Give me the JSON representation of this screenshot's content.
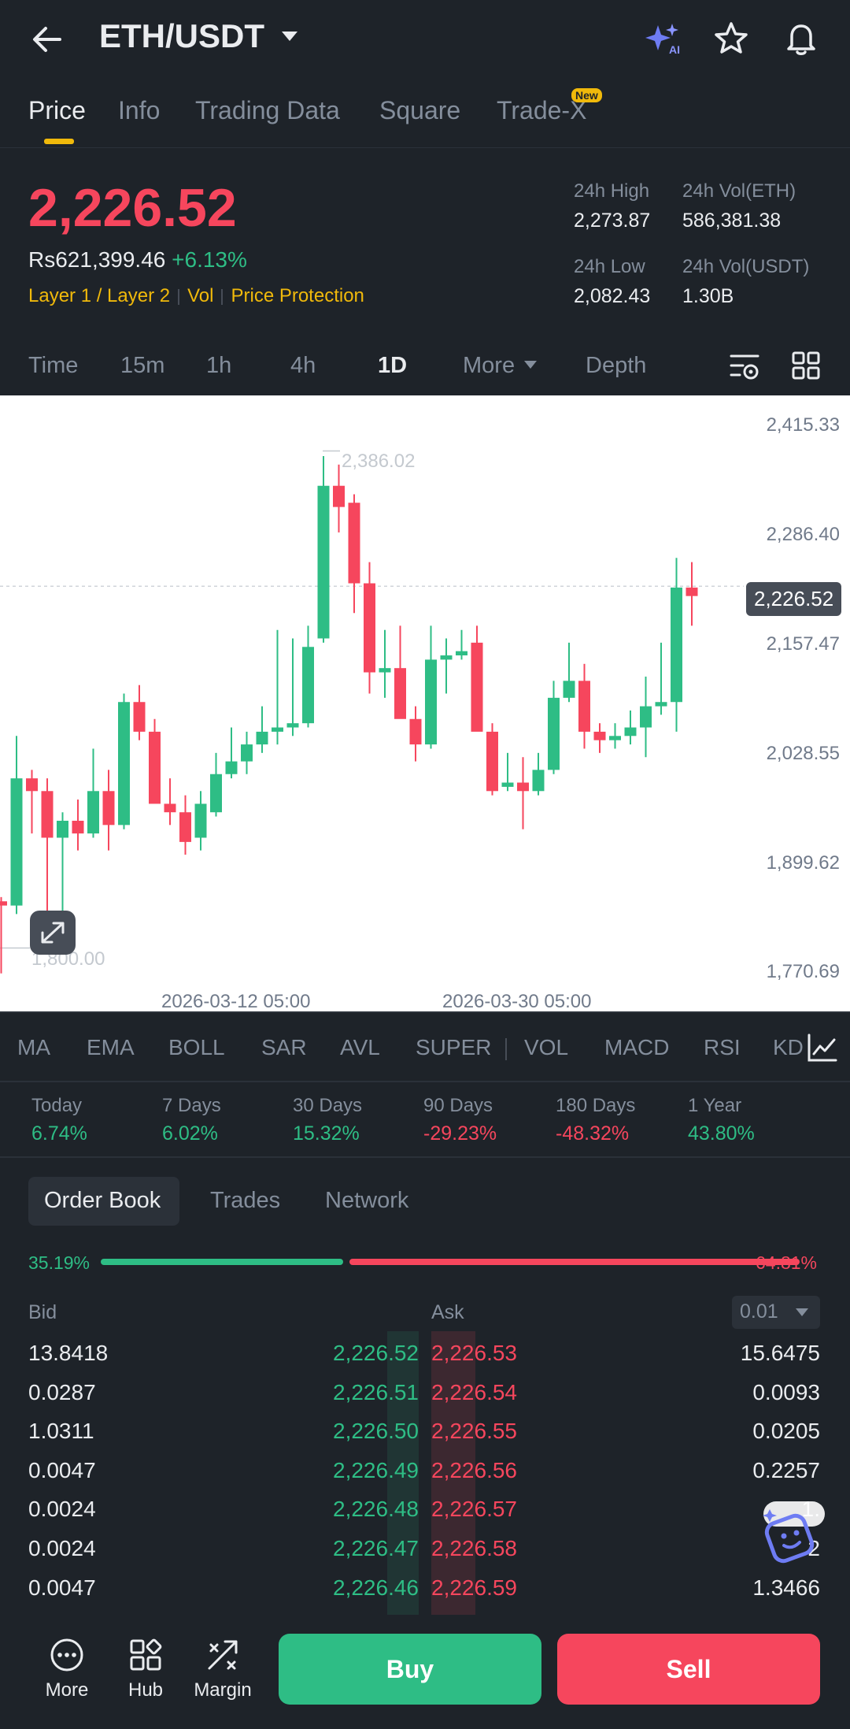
{
  "header": {
    "pair": "ETH/USDT"
  },
  "tabs": [
    {
      "label": "Price"
    },
    {
      "label": "Info"
    },
    {
      "label": "Trading Data"
    },
    {
      "label": "Square"
    },
    {
      "label": "Trade-X"
    }
  ],
  "new_badge": "New",
  "ticker": {
    "last_price": "2,226.52",
    "fiat_price": "Rs621,399.46",
    "change": "+6.13%",
    "tags": [
      "Layer 1 / Layer 2",
      "Vol",
      "Price Protection"
    ],
    "high_label": "24h High",
    "high": "2,273.87",
    "vol_base_label": "24h Vol(ETH)",
    "vol_base": "586,381.38",
    "low_label": "24h Low",
    "low": "2,082.43",
    "vol_quote_label": "24h Vol(USDT)",
    "vol_quote": "1.30B"
  },
  "timeframes": [
    "Time",
    "15m",
    "1h",
    "4h",
    "1D",
    "More",
    "Depth"
  ],
  "active_timeframe": "1D",
  "chart_data": {
    "type": "candlestick",
    "interval": "1D",
    "y_ticks": [
      "2,415.33",
      "2,286.40",
      "2,157.47",
      "2,028.55",
      "1,899.62",
      "1,770.69"
    ],
    "x_ticks": [
      "2026-03-12 05:00",
      "2026-03-30 05:00"
    ],
    "last_price_label": "2,226.52",
    "max_label": "2,386.02",
    "min_label": "1,800.00",
    "ylim": [
      1770.69,
      2415.33
    ],
    "candles": [
      {
        "o": 1855,
        "h": 1860,
        "l": 1770,
        "c": 1850
      },
      {
        "o": 1850,
        "h": 2050,
        "l": 1840,
        "c": 2000
      },
      {
        "o": 2000,
        "h": 2010,
        "l": 1935,
        "c": 1985
      },
      {
        "o": 1985,
        "h": 2000,
        "l": 1835,
        "c": 1930
      },
      {
        "o": 1930,
        "h": 1960,
        "l": 1840,
        "c": 1950
      },
      {
        "o": 1950,
        "h": 1975,
        "l": 1915,
        "c": 1935
      },
      {
        "o": 1935,
        "h": 2035,
        "l": 1930,
        "c": 1985
      },
      {
        "o": 1985,
        "h": 2010,
        "l": 1915,
        "c": 1945
      },
      {
        "o": 1945,
        "h": 2100,
        "l": 1940,
        "c": 2090
      },
      {
        "o": 2090,
        "h": 2110,
        "l": 2045,
        "c": 2055
      },
      {
        "o": 2055,
        "h": 2070,
        "l": 1985,
        "c": 1970
      },
      {
        "o": 1970,
        "h": 2000,
        "l": 1945,
        "c": 1960
      },
      {
        "o": 1960,
        "h": 1980,
        "l": 1910,
        "c": 1925
      },
      {
        "o": 1930,
        "h": 1985,
        "l": 1915,
        "c": 1970
      },
      {
        "o": 1960,
        "h": 2030,
        "l": 1955,
        "c": 2005
      },
      {
        "o": 2005,
        "h": 2060,
        "l": 2000,
        "c": 2020
      },
      {
        "o": 2020,
        "h": 2055,
        "l": 2005,
        "c": 2040
      },
      {
        "o": 2040,
        "h": 2085,
        "l": 2030,
        "c": 2055
      },
      {
        "o": 2055,
        "h": 2175,
        "l": 2040,
        "c": 2060
      },
      {
        "o": 2060,
        "h": 2165,
        "l": 2050,
        "c": 2065
      },
      {
        "o": 2065,
        "h": 2180,
        "l": 2060,
        "c": 2155
      },
      {
        "o": 2165,
        "h": 2380,
        "l": 2160,
        "c": 2345
      },
      {
        "o": 2345,
        "h": 2370,
        "l": 2290,
        "c": 2320
      },
      {
        "o": 2325,
        "h": 2335,
        "l": 2195,
        "c": 2230
      },
      {
        "o": 2230,
        "h": 2255,
        "l": 2100,
        "c": 2125
      },
      {
        "o": 2125,
        "h": 2175,
        "l": 2095,
        "c": 2130
      },
      {
        "o": 2130,
        "h": 2180,
        "l": 2090,
        "c": 2070
      },
      {
        "o": 2070,
        "h": 2085,
        "l": 2020,
        "c": 2040
      },
      {
        "o": 2040,
        "h": 2180,
        "l": 2035,
        "c": 2140
      },
      {
        "o": 2140,
        "h": 2165,
        "l": 2100,
        "c": 2145
      },
      {
        "o": 2145,
        "h": 2175,
        "l": 2140,
        "c": 2150
      },
      {
        "o": 2160,
        "h": 2180,
        "l": 2060,
        "c": 2055
      },
      {
        "o": 2055,
        "h": 2065,
        "l": 1980,
        "c": 1985
      },
      {
        "o": 1990,
        "h": 2030,
        "l": 1985,
        "c": 1995
      },
      {
        "o": 1995,
        "h": 2025,
        "l": 1940,
        "c": 1985
      },
      {
        "o": 1985,
        "h": 2030,
        "l": 1980,
        "c": 2010
      },
      {
        "o": 2010,
        "h": 2115,
        "l": 2005,
        "c": 2095
      },
      {
        "o": 2095,
        "h": 2160,
        "l": 2090,
        "c": 2115
      },
      {
        "o": 2115,
        "h": 2135,
        "l": 2035,
        "c": 2055
      },
      {
        "o": 2055,
        "h": 2065,
        "l": 2030,
        "c": 2045
      },
      {
        "o": 2045,
        "h": 2065,
        "l": 2035,
        "c": 2050
      },
      {
        "o": 2050,
        "h": 2080,
        "l": 2040,
        "c": 2060
      },
      {
        "o": 2060,
        "h": 2120,
        "l": 2025,
        "c": 2085
      },
      {
        "o": 2085,
        "h": 2160,
        "l": 2075,
        "c": 2090
      },
      {
        "o": 2090,
        "h": 2260,
        "l": 2055,
        "c": 2225
      },
      {
        "o": 2225,
        "h": 2255,
        "l": 2180,
        "c": 2215
      }
    ]
  },
  "indicators": [
    "MA",
    "EMA",
    "BOLL",
    "SAR",
    "AVL",
    "SUPER",
    "VOL",
    "MACD",
    "RSI",
    "KD"
  ],
  "periods": [
    {
      "label": "Today",
      "value": "6.74%",
      "sign": "pos"
    },
    {
      "label": "7 Days",
      "value": "6.02%",
      "sign": "pos"
    },
    {
      "label": "30 Days",
      "value": "15.32%",
      "sign": "pos"
    },
    {
      "label": "90 Days",
      "value": "-29.23%",
      "sign": "neg"
    },
    {
      "label": "180 Days",
      "value": "-48.32%",
      "sign": "neg"
    },
    {
      "label": "1 Year",
      "value": "43.80%",
      "sign": "pos"
    }
  ],
  "orderbook": {
    "tabs": [
      "Order Book",
      "Trades",
      "Network"
    ],
    "bid_ratio": "35.19%",
    "ask_ratio": "64.81%",
    "bid_fraction": 0.3519,
    "bid_label": "Bid",
    "ask_label": "Ask",
    "precision": "0.01",
    "rows": [
      {
        "bid_qty": "13.8418",
        "bid_price": "2,226.52",
        "ask_price": "2,226.53",
        "ask_qty": "15.6475"
      },
      {
        "bid_qty": "0.0287",
        "bid_price": "2,226.51",
        "ask_price": "2,226.54",
        "ask_qty": "0.0093"
      },
      {
        "bid_qty": "1.0311",
        "bid_price": "2,226.50",
        "ask_price": "2,226.55",
        "ask_qty": "0.0205"
      },
      {
        "bid_qty": "0.0047",
        "bid_price": "2,226.49",
        "ask_price": "2,226.56",
        "ask_qty": "0.2257"
      },
      {
        "bid_qty": "0.0024",
        "bid_price": "2,226.48",
        "ask_price": "2,226.57",
        "ask_qty": "1."
      },
      {
        "bid_qty": "0.0024",
        "bid_price": "2,226.47",
        "ask_price": "2,226.58",
        "ask_qty": "2"
      },
      {
        "bid_qty": "0.0047",
        "bid_price": "2,226.46",
        "ask_price": "2,226.59",
        "ask_qty": "1.3466"
      }
    ]
  },
  "bottom": {
    "more": "More",
    "hub": "Hub",
    "margin": "Margin",
    "buy": "Buy",
    "sell": "Sell"
  },
  "colors": {
    "up": "#2ebd85",
    "down": "#f6465d",
    "accent": "#f0b90b",
    "bg": "#1e2329"
  }
}
